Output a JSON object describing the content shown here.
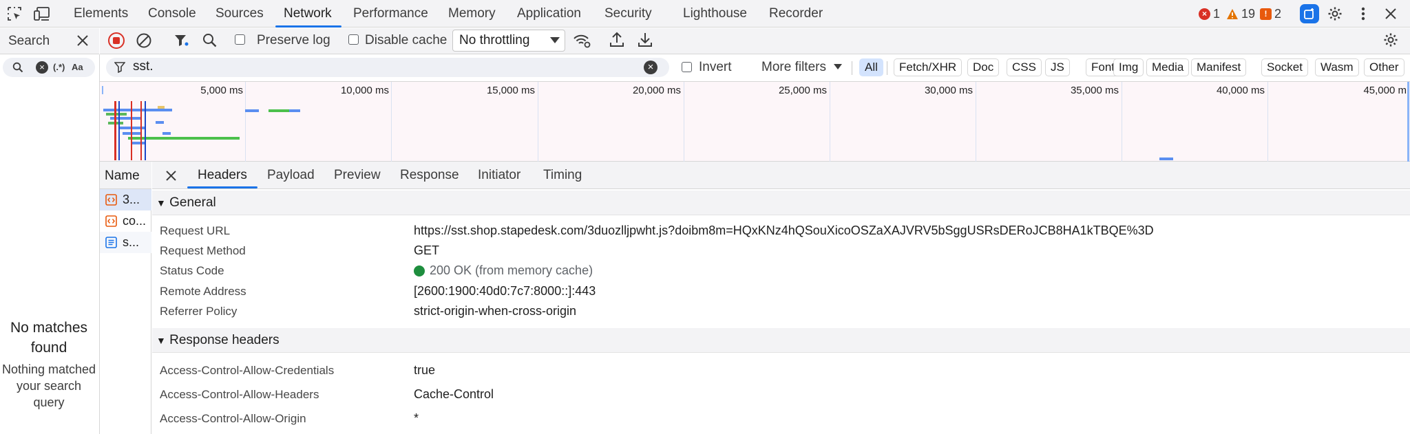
{
  "topbar": {
    "tabs": [
      "Elements",
      "Console",
      "Sources",
      "Network",
      "Performance",
      "Memory",
      "Application",
      "Security",
      "Lighthouse",
      "Recorder"
    ],
    "active_tab": "Network",
    "errors_count": "1",
    "warnings_count": "19",
    "issues_count": "2"
  },
  "search": {
    "title": "Search",
    "regex_label": "(.*)",
    "case_label": "Aa",
    "no_matches": "No matches found",
    "no_matches_sub": "Nothing matched your search query"
  },
  "toolbar": {
    "preserve_log": "Preserve log",
    "disable_cache": "Disable cache",
    "throttling": "No throttling"
  },
  "filter": {
    "value": "sst.",
    "invert": "Invert",
    "more_filters": "More filters",
    "types": [
      "All",
      "Fetch/XHR",
      "Doc",
      "CSS",
      "JS",
      "Font",
      "Img",
      "Media",
      "Manifest",
      "Socket",
      "Wasm",
      "Other"
    ],
    "active_type": "All"
  },
  "overview": {
    "ticks": [
      "5,000 ms",
      "10,000 ms",
      "15,000 ms",
      "20,000 ms",
      "25,000 ms",
      "30,000 ms",
      "35,000 ms",
      "40,000 ms",
      "45,000 m"
    ]
  },
  "requests": {
    "header": "Name",
    "rows": [
      {
        "name": "3...",
        "icon": "script-icon"
      },
      {
        "name": "co...",
        "icon": "script-icon"
      },
      {
        "name": "s...",
        "icon": "document-icon"
      }
    ]
  },
  "details": {
    "tabs": [
      "Headers",
      "Payload",
      "Preview",
      "Response",
      "Initiator",
      "Timing"
    ],
    "active_tab": "Headers",
    "general_title": "General",
    "general": [
      {
        "key": "Request URL",
        "value": "https://sst.shop.stapedesk.com/3duozlljpwht.js?doibm8m=HQxKNz4hQSouXicoOSZaXAJVRV5bSggUSRsDERoJCB8HA1kTBQE%3D"
      },
      {
        "key": "Request Method",
        "value": "GET"
      },
      {
        "key": "Status Code",
        "value": "200 OK (from memory cache)"
      },
      {
        "key": "Remote Address",
        "value": "[2600:1900:40d0:7c7:8000::]:443"
      },
      {
        "key": "Referrer Policy",
        "value": "strict-origin-when-cross-origin"
      }
    ],
    "response_title": "Response headers",
    "response": [
      {
        "key": "Access-Control-Allow-Credentials",
        "value": "true"
      },
      {
        "key": "Access-Control-Allow-Headers",
        "value": "Cache-Control"
      },
      {
        "key": "Access-Control-Allow-Origin",
        "value": "*"
      }
    ]
  },
  "colors": {
    "accent": "#1a73e8",
    "error": "#d93025",
    "warning": "#e37400",
    "status_ok": "#1e8e3e"
  }
}
